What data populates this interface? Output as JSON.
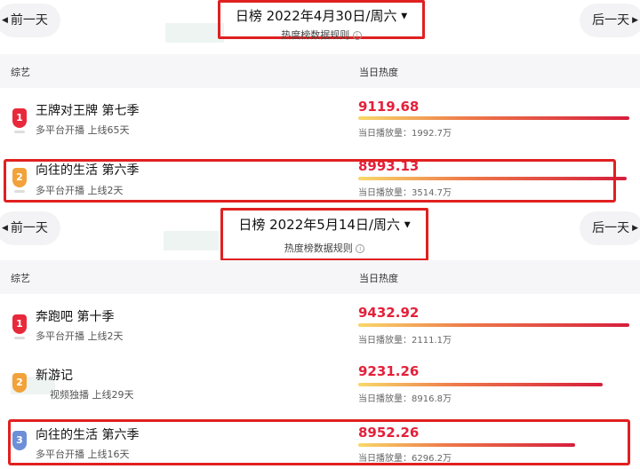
{
  "panels": [
    {
      "prev_label": "前一天",
      "next_label": "后一天",
      "date_title": "日榜 2022年4月30日/周六",
      "rules_label": "热度榜数据规则",
      "col_category": "综艺",
      "col_heat": "当日热度",
      "rows": [
        {
          "rank": "1",
          "name": "王牌对王牌 第七季",
          "sub": "多平台开播  上线65天",
          "heat": "9119.68",
          "plays": "当日播放量：1992.7万",
          "heat_fraction": 1.0
        },
        {
          "rank": "2",
          "name": "向往的生活 第六季",
          "sub": "多平台开播  上线2天",
          "heat": "8993.13",
          "plays": "当日播放量：3514.7万",
          "heat_fraction": 0.99
        }
      ]
    },
    {
      "prev_label": "前一天",
      "next_label": "后一天",
      "date_title": "日榜 2022年5月14日/周六",
      "rules_label": "热度榜数据规则",
      "col_category": "综艺",
      "col_heat": "当日热度",
      "rows": [
        {
          "rank": "1",
          "name": "奔跑吧 第十季",
          "sub": "多平台开播  上线2天",
          "heat": "9432.92",
          "plays": "当日播放量：2111.1万",
          "heat_fraction": 1.0
        },
        {
          "rank": "2",
          "name": "新游记",
          "sub": "视频独播  上线29天",
          "heat": "9231.26",
          "plays": "当日播放量：8916.8万",
          "heat_fraction": 0.9
        },
        {
          "rank": "3",
          "name": "向往的生活 第六季",
          "sub": "多平台开播  上线16天",
          "heat": "8952.26",
          "plays": "当日播放量：6296.2万",
          "heat_fraction": 0.8
        }
      ]
    }
  ],
  "icons": {
    "prev": "triangle-left",
    "next": "triangle-right",
    "dropdown": "caret-down",
    "info": "info-circle"
  }
}
